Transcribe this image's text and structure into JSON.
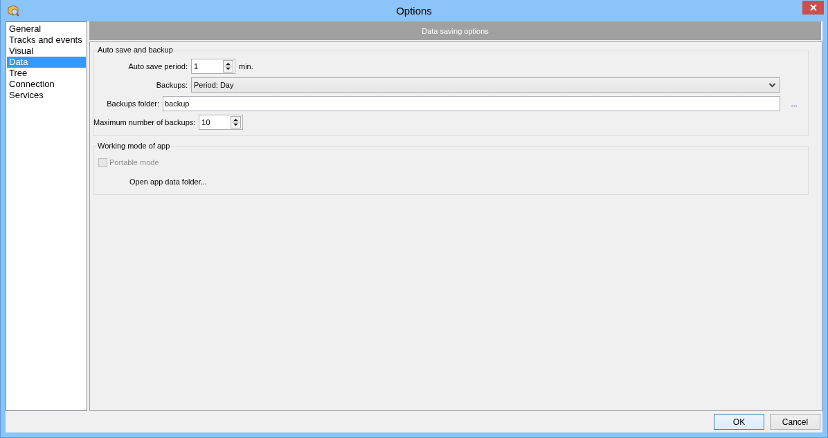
{
  "window": {
    "title": "Options"
  },
  "sidebar": {
    "items": [
      {
        "label": "General",
        "selected": false
      },
      {
        "label": "Tracks and events",
        "selected": false
      },
      {
        "label": "Visual",
        "selected": false
      },
      {
        "label": "Data",
        "selected": true
      },
      {
        "label": "Tree",
        "selected": false
      },
      {
        "label": "Connection",
        "selected": false
      },
      {
        "label": "Services",
        "selected": false
      }
    ]
  },
  "header": "Data saving options",
  "groups": [
    {
      "title": "Auto save and backup",
      "rows": [
        {
          "kind": "spin",
          "label": "Auto save period:",
          "value": "1",
          "suffix": "min."
        },
        {
          "kind": "combo",
          "label": "Backups:",
          "value": "Period: Day"
        },
        {
          "kind": "text",
          "label": "Backups folder:",
          "value": "backup",
          "button": "..."
        },
        {
          "kind": "spin",
          "label": "Maximum number of backups:",
          "value": "10"
        }
      ]
    },
    {
      "title": "Working mode of app",
      "rows": [
        {
          "kind": "checkbox",
          "label": "Portable mode",
          "checked": false,
          "disabled": true
        },
        {
          "kind": "link",
          "label": "Open app data folder..."
        }
      ]
    }
  ],
  "buttons": [
    {
      "label": "OK",
      "default": true
    },
    {
      "label": "Cancel",
      "default": false
    }
  ]
}
